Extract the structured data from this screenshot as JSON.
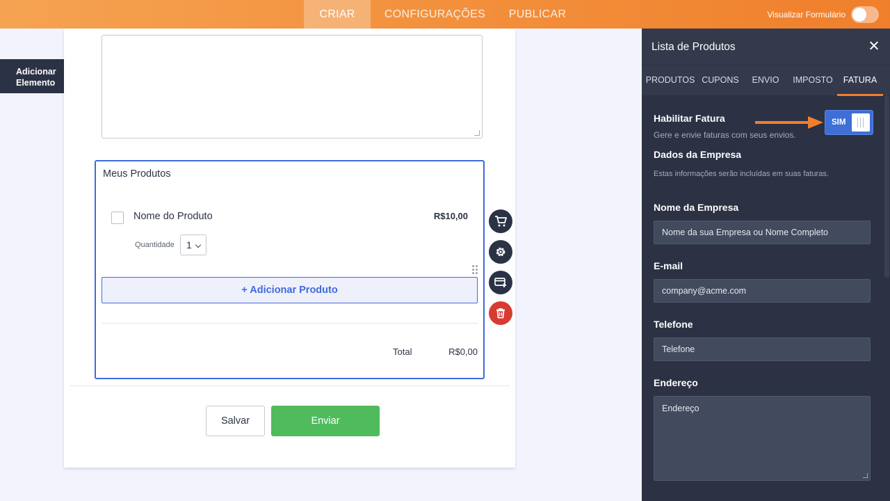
{
  "topbar": {
    "tabs": [
      {
        "label": "CRIAR",
        "active": true
      },
      {
        "label": "CONFIGURAÇÕES",
        "active": false
      },
      {
        "label": "PUBLICAR",
        "active": false
      }
    ],
    "preview_label": "Visualizar Formulário",
    "preview_enabled": false
  },
  "add_element": {
    "label": "Adicionar Elemento"
  },
  "product_list": {
    "title": "Meus Produtos",
    "product": {
      "name": "Nome do Produto",
      "price": "R$10,00",
      "quantity_label": "Quantidade",
      "quantity_value": "1"
    },
    "add_button": "+ Adicionar Produto",
    "total_label": "Total",
    "total_value": "R$0,00"
  },
  "buttons": {
    "save": "Salvar",
    "send": "Enviar"
  },
  "tools": [
    "cart-icon",
    "gear-icon",
    "add-card-icon",
    "trash-icon"
  ],
  "panel": {
    "title": "Lista de Produtos",
    "tabs": [
      {
        "label": "PRODUTOS",
        "active": false
      },
      {
        "label": "CUPONS",
        "active": false
      },
      {
        "label": "ENVIO",
        "active": false
      },
      {
        "label": "IMPOSTO",
        "active": false
      },
      {
        "label": "FATURA",
        "active": true
      }
    ],
    "enable_invoice": {
      "label": "Habilitar Fatura",
      "description": "Gere e envie faturas com seus envios.",
      "toggle_label": "SIM",
      "enabled": true
    },
    "company_data": {
      "label": "Dados da Empresa",
      "description": "Estas informações serão incluídas em suas faturas."
    },
    "company_name": {
      "label": "Nome da Empresa",
      "value": "Nome da sua Empresa ou Nome Completo"
    },
    "email": {
      "label": "E-mail",
      "value": "company@acme.com"
    },
    "phone": {
      "label": "Telefone",
      "value": "Telefone"
    },
    "address": {
      "label": "Endereço",
      "value": "Endereço"
    }
  },
  "colors": {
    "accent": "#f07f2c",
    "primary": "#3f6bdc",
    "success": "#4fbb5d",
    "danger": "#d63c33",
    "panel_bg": "#2c3143"
  }
}
